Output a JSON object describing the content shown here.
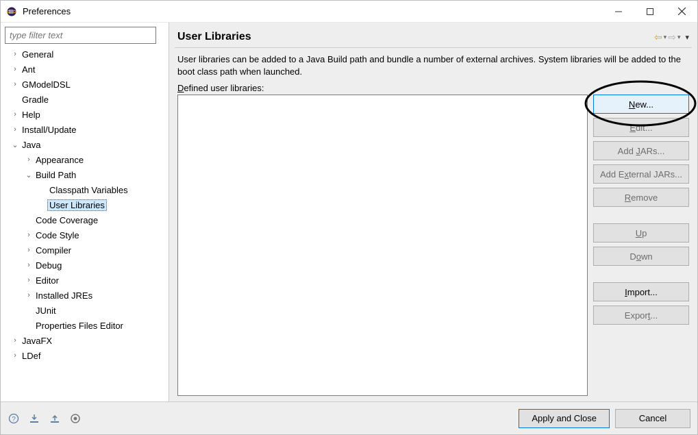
{
  "window": {
    "title": "Preferences"
  },
  "sidebar": {
    "filter_placeholder": "type filter text",
    "items": [
      {
        "label": "General",
        "expand": "closed",
        "depth": 0
      },
      {
        "label": "Ant",
        "expand": "closed",
        "depth": 0
      },
      {
        "label": "GModelDSL",
        "expand": "closed",
        "depth": 0
      },
      {
        "label": "Gradle",
        "expand": "none",
        "depth": 0
      },
      {
        "label": "Help",
        "expand": "closed",
        "depth": 0
      },
      {
        "label": "Install/Update",
        "expand": "closed",
        "depth": 0
      },
      {
        "label": "Java",
        "expand": "open",
        "depth": 0
      },
      {
        "label": "Appearance",
        "expand": "closed",
        "depth": 1
      },
      {
        "label": "Build Path",
        "expand": "open",
        "depth": 1
      },
      {
        "label": "Classpath Variables",
        "expand": "none",
        "depth": 2
      },
      {
        "label": "User Libraries",
        "expand": "none",
        "depth": 2,
        "selected": true
      },
      {
        "label": "Code Coverage",
        "expand": "none",
        "depth": 1
      },
      {
        "label": "Code Style",
        "expand": "closed",
        "depth": 1
      },
      {
        "label": "Compiler",
        "expand": "closed",
        "depth": 1
      },
      {
        "label": "Debug",
        "expand": "closed",
        "depth": 1
      },
      {
        "label": "Editor",
        "expand": "closed",
        "depth": 1
      },
      {
        "label": "Installed JREs",
        "expand": "closed",
        "depth": 1
      },
      {
        "label": "JUnit",
        "expand": "none",
        "depth": 1
      },
      {
        "label": "Properties Files Editor",
        "expand": "none",
        "depth": 1
      },
      {
        "label": "JavaFX",
        "expand": "closed",
        "depth": 0
      },
      {
        "label": "LDef",
        "expand": "closed",
        "depth": 0
      }
    ]
  },
  "main": {
    "title": "User Libraries",
    "description": "User libraries can be added to a Java Build path and bundle a number of external archives. System libraries will be added to the boot class path when launched.",
    "defined_label_pre": "D",
    "defined_label_rest": "efined user libraries:"
  },
  "buttons": {
    "new": "New...",
    "edit": "Edit...",
    "add_jars_pre": "Add ",
    "add_jars_u": "J",
    "add_jars_post": "ARs...",
    "add_ext_pre": "Add E",
    "add_ext_u": "x",
    "add_ext_post": "ternal JARs...",
    "remove_u": "R",
    "remove_post": "emove",
    "up_u": "U",
    "up_post": "p",
    "down": "Down",
    "import_u": "I",
    "import_post": "mport...",
    "export": "Export..."
  },
  "footer": {
    "apply_close": "Apply and Close",
    "cancel": "Cancel"
  }
}
